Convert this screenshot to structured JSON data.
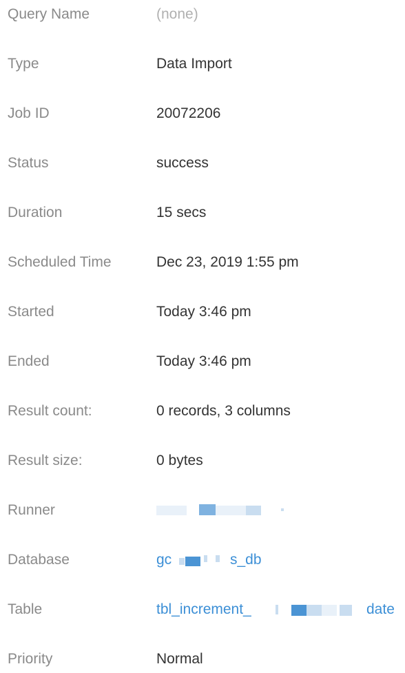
{
  "details": {
    "rows": [
      {
        "label": "Query Name",
        "value": "(none)"
      },
      {
        "label": "Type",
        "value": "Data Import"
      },
      {
        "label": "Job ID",
        "value": "20072206"
      },
      {
        "label": "Status",
        "value": "success"
      },
      {
        "label": "Duration",
        "value": "15 secs"
      },
      {
        "label": "Scheduled Time",
        "value": "Dec 23, 2019 1:55 pm"
      },
      {
        "label": "Started",
        "value": "Today 3:46 pm"
      },
      {
        "label": "Ended",
        "value": "Today 3:46 pm"
      },
      {
        "label": "Result count:",
        "value": "0 records, 3 columns"
      },
      {
        "label": "Result size:",
        "value": "0 bytes"
      },
      {
        "label": "Runner",
        "value": ""
      },
      {
        "label": "Database",
        "value_start": "gc",
        "value_end": "s_db"
      },
      {
        "label": "Table",
        "value_start": "tbl_increment_",
        "value_end": "date"
      },
      {
        "label": "Priority",
        "value": "Normal"
      }
    ]
  },
  "colors": {
    "label": "#8a8a8a",
    "value": "#333333",
    "muted": "#b0b0b0",
    "link": "#3c8fd6"
  }
}
